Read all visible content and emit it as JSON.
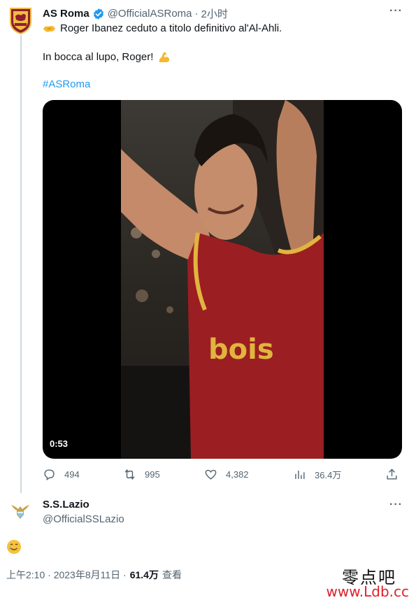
{
  "tweet": {
    "author_name": "AS Roma",
    "author_handle": "@OfficialASRoma",
    "separator": "·",
    "time_ago": "2小时",
    "line1": "Roger Ibanez ceduto a titolo definitivo al'Al-Ahli.",
    "line2": "In bocca al lupo, Roger!",
    "hashtag": "#ASRoma",
    "video_duration": "0:53",
    "jersey_text": "bois",
    "actions": {
      "reply_count": "494",
      "retweet_count": "995",
      "like_count": "4,382",
      "views_count": "36.4万"
    }
  },
  "quote": {
    "author_name": "S.S.Lazio",
    "author_handle": "@OfficialSSLazio",
    "body_emoji": "🥲",
    "timestamp": "上午2:10 · 2023年8月11日 ·",
    "views_value": "61.4万",
    "views_label": "查看"
  },
  "watermark": {
    "cn": "零点吧",
    "url": "www.Ldb.cc"
  },
  "colors": {
    "accent": "#1d9bf0",
    "secondary_text": "#536471",
    "thread_line": "#cfd9de"
  }
}
